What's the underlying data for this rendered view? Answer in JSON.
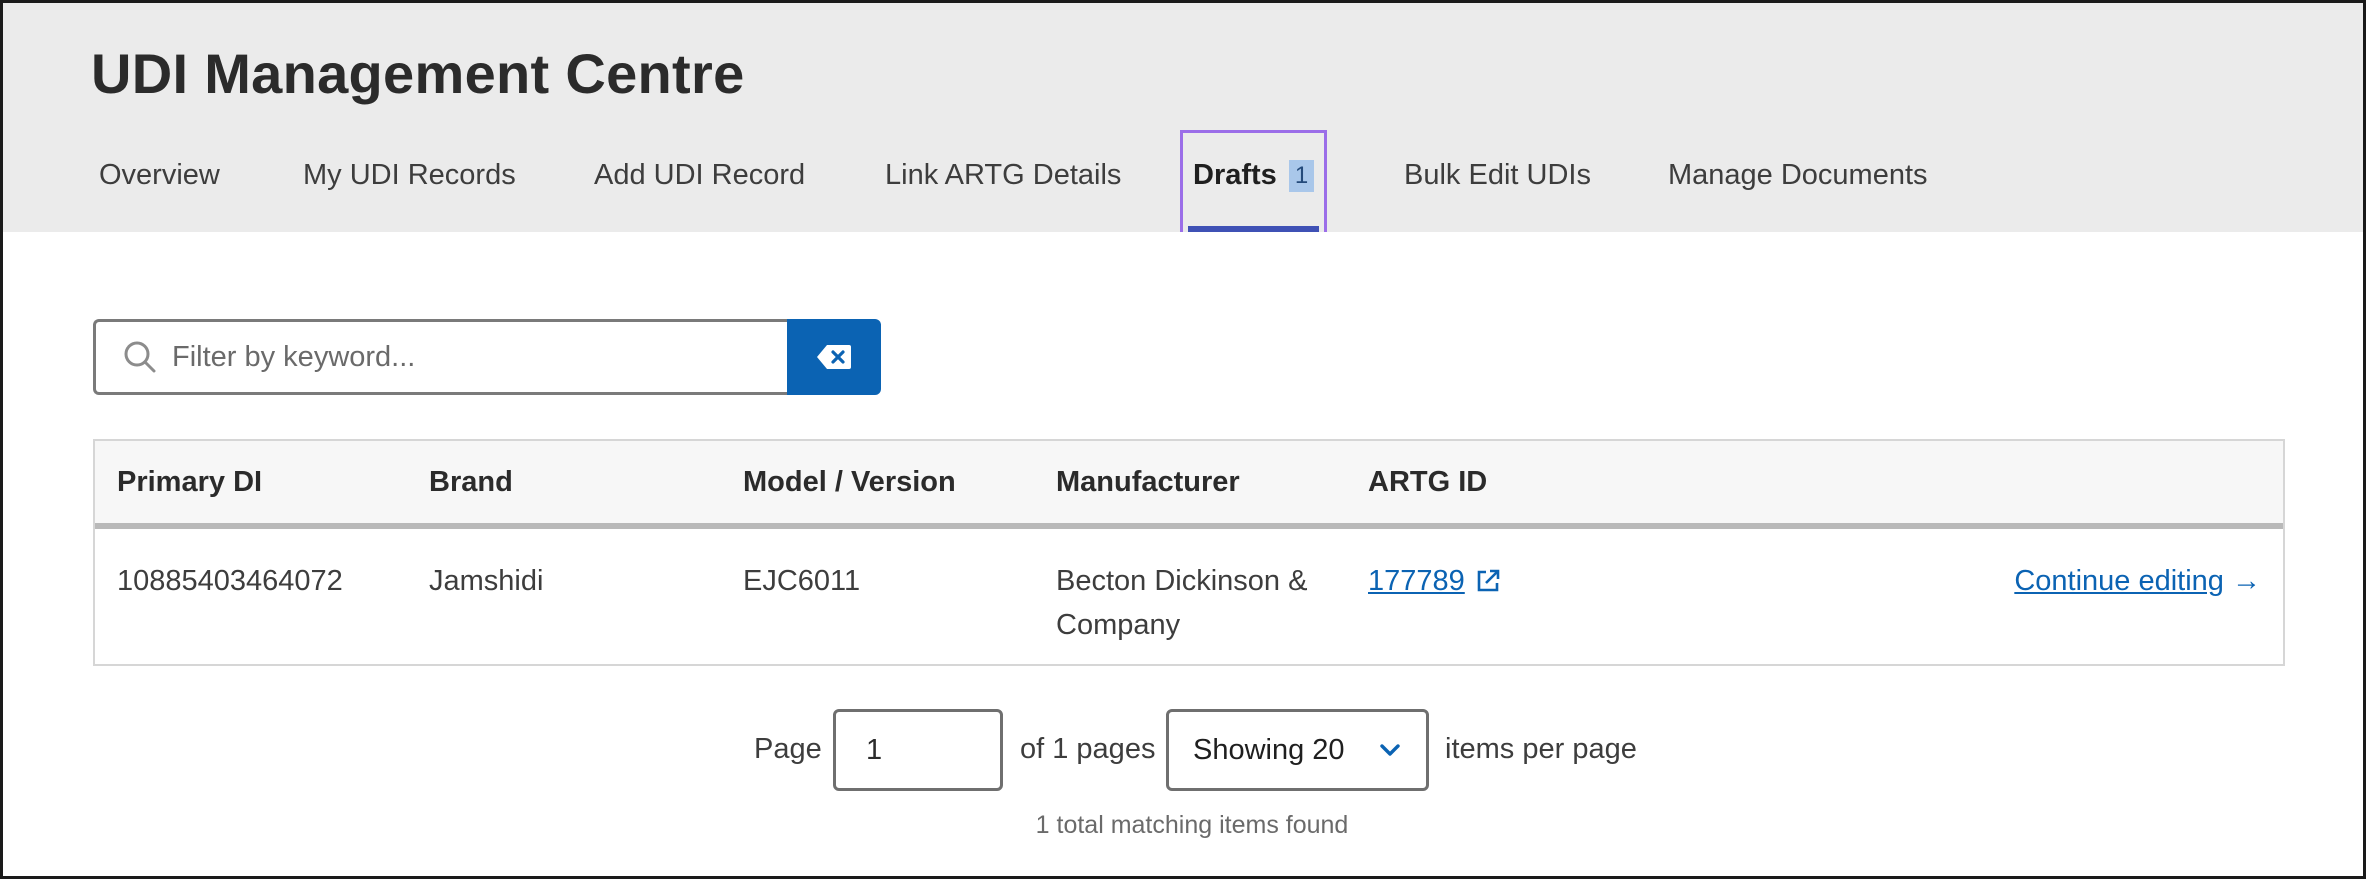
{
  "header": {
    "title": "UDI Management Centre",
    "tabs": [
      {
        "label": "Overview"
      },
      {
        "label": "My UDI Records"
      },
      {
        "label": "Add UDI Record"
      },
      {
        "label": "Link ARTG Details"
      },
      {
        "label": "Drafts",
        "badge": "1",
        "active": true
      },
      {
        "label": "Bulk Edit UDIs"
      },
      {
        "label": "Manage Documents"
      }
    ]
  },
  "search": {
    "placeholder": "Filter by keyword...",
    "value": ""
  },
  "table": {
    "columns": [
      "Primary DI",
      "Brand",
      "Model / Version",
      "Manufacturer",
      "ARTG ID"
    ],
    "rows": [
      {
        "primary_di": "10885403464072",
        "brand": "Jamshidi",
        "model": "EJC6011",
        "manufacturer": "Becton Dickinson & Company",
        "artg_id": "177789",
        "action": "Continue editing",
        "action_arrow": "→"
      }
    ]
  },
  "pagination": {
    "page_label": "Page",
    "page_value": "1",
    "of_pages": "of 1 pages",
    "per_page_selected": "Showing 20",
    "per_page_suffix": "items per page",
    "total": "1 total matching items found"
  },
  "colors": {
    "accent": "#0b63b3",
    "active_tab_underline": "#3f51b5",
    "focus_outline": "#9b6ee8",
    "header_bg": "#ebebeb"
  },
  "icons": {
    "search": "search-icon",
    "clear": "backspace-x-icon",
    "external": "external-link-icon",
    "dropdown": "chevron-down-icon"
  }
}
